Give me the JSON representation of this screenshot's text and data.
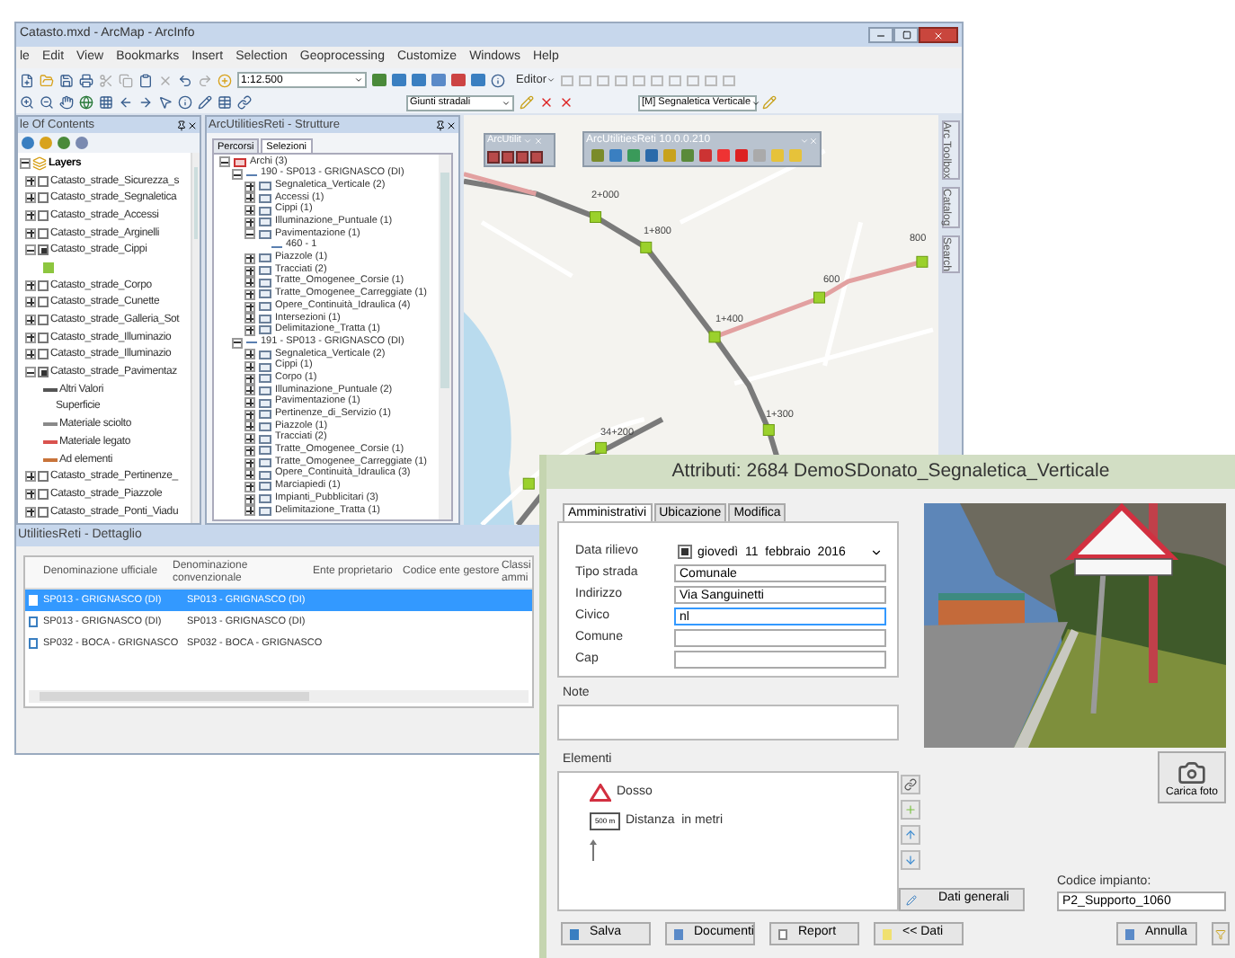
{
  "arcmap": {
    "title": "Catasto.mxd - ArcMap - ArcInfo",
    "menu": [
      "le",
      "Edit",
      "View",
      "Bookmarks",
      "Insert",
      "Selection",
      "Geoprocessing",
      "Customize",
      "Windows",
      "Help"
    ],
    "scale": "1:12.500",
    "editor": "Editor",
    "layer_combo": "Giunti stradali",
    "target_combo": "[M] Segnaletica Verticale"
  },
  "toc": {
    "title": "le Of Contents",
    "items": [
      {
        "label": "Layers",
        "kind": "root",
        "expanded": true,
        "children": [
          {
            "label": "Catasto_strade_Sicurezza_s",
            "kind": "layer",
            "checked": false,
            "expanded": false
          },
          {
            "label": "Catasto_strade_Segnaletica",
            "kind": "layer",
            "checked": false,
            "expanded": false
          },
          {
            "label": "Catasto_strade_Accessi",
            "kind": "layer",
            "checked": false,
            "expanded": false
          },
          {
            "label": "Catasto_strade_Arginelli",
            "kind": "layer",
            "checked": false,
            "expanded": false
          },
          {
            "label": "Catasto_strade_Cippi",
            "kind": "layer",
            "checked": true,
            "expanded": true,
            "children": [
              {
                "kind": "legend",
                "color": "#8dc63f"
              }
            ]
          },
          {
            "label": "Catasto_strade_Corpo",
            "kind": "layer",
            "checked": false,
            "expanded": false
          },
          {
            "label": "Catasto_strade_Cunette",
            "kind": "layer",
            "checked": false,
            "expanded": false
          },
          {
            "label": "Catasto_strade_Galleria_Sot",
            "kind": "layer",
            "checked": false,
            "expanded": false
          },
          {
            "label": "Catasto_strade_Illuminazio",
            "kind": "layer",
            "checked": false,
            "expanded": false
          },
          {
            "label": "Catasto_strade_Illuminazio",
            "kind": "layer",
            "checked": false,
            "expanded": false
          },
          {
            "label": "Catasto_strade_Pavimentaz",
            "kind": "layer",
            "checked": true,
            "expanded": true,
            "children": [
              {
                "label": "Altri Valori",
                "kind": "legend",
                "color": "#555555"
              },
              {
                "label": "Superficie",
                "kind": "heading"
              },
              {
                "label": "Materiale sciolto",
                "kind": "legend",
                "color": "#8a8a8a"
              },
              {
                "label": "Materiale legato",
                "kind": "legend",
                "color": "#d9534f"
              },
              {
                "label": "Ad elementi",
                "kind": "legend",
                "color": "#c8743a"
              }
            ]
          },
          {
            "label": "Catasto_strade_Pertinenze_",
            "kind": "layer",
            "checked": false,
            "expanded": false
          },
          {
            "label": "Catasto_strade_Piazzole",
            "kind": "layer",
            "checked": false,
            "expanded": false
          },
          {
            "label": "Catasto_strade_Ponti_Viadu",
            "kind": "layer",
            "checked": false,
            "expanded": false
          }
        ]
      }
    ]
  },
  "structure": {
    "title": "ArcUtilitiesReti - Strutture",
    "tabs": [
      {
        "label": "Percorsi",
        "selected": false
      },
      {
        "label": "Selezioni",
        "selected": true
      }
    ],
    "tree": [
      {
        "label": "Archi (3)",
        "expanded": true,
        "children": [
          {
            "label": "190 - SP013 - GRIGNASCO (DI)",
            "expanded": true,
            "children": [
              {
                "label": "Segnaletica_Verticale (2)",
                "expanded": false
              },
              {
                "label": "Accessi (1)",
                "expanded": false
              },
              {
                "label": "Cippi (1)",
                "expanded": false
              },
              {
                "label": "Illuminazione_Puntuale (1)",
                "expanded": false
              },
              {
                "label": "Pavimentazione (1)",
                "expanded": true,
                "children": [
                  {
                    "label": "460 - 1"
                  }
                ]
              },
              {
                "label": "Piazzole (1)",
                "expanded": false
              },
              {
                "label": "Tracciati (2)",
                "expanded": false
              },
              {
                "label": "Tratte_Omogenee_Corsie (1)",
                "expanded": false
              },
              {
                "label": "Tratte_Omogenee_Carreggiate (1)",
                "expanded": false
              },
              {
                "label": "Opere_Continuità_Idraulica (4)",
                "expanded": false
              },
              {
                "label": "Intersezioni (1)",
                "expanded": false
              },
              {
                "label": "Delimitazione_Tratta (1)",
                "expanded": false
              }
            ]
          },
          {
            "label": "191 - SP013 - GRIGNASCO (DI)",
            "expanded": true,
            "children": [
              {
                "label": "Segnaletica_Verticale (2)",
                "expanded": false
              },
              {
                "label": "Cippi (1)",
                "expanded": false
              },
              {
                "label": "Corpo (1)",
                "expanded": false
              },
              {
                "label": "Illuminazione_Puntuale (2)",
                "expanded": false
              },
              {
                "label": "Pavimentazione (1)",
                "expanded": false
              },
              {
                "label": "Pertinenze_di_Servizio (1)",
                "expanded": false
              },
              {
                "label": "Piazzole (1)",
                "expanded": false
              },
              {
                "label": "Tracciati (2)",
                "expanded": false
              },
              {
                "label": "Tratte_Omogenee_Corsie (1)",
                "expanded": false
              },
              {
                "label": "Tratte_Omogenee_Carreggiate (1)",
                "expanded": false
              },
              {
                "label": "Opere_Continuità_Idraulica (3)",
                "expanded": false
              },
              {
                "label": "Marciapiedi (1)",
                "expanded": false
              },
              {
                "label": "Impianti_Pubblicitari (3)",
                "expanded": false
              },
              {
                "label": "Delimitazione_Tratta (1)",
                "expanded": false
              }
            ]
          }
        ]
      }
    ]
  },
  "map": {
    "toolbars": [
      "ArcUtilit",
      "ArcUtilitiesReti 10.0.0.210"
    ],
    "labels": [
      "2+000",
      "1+800",
      "1+400",
      "1+300",
      "34+200",
      "800",
      "600"
    ],
    "dock_tabs": [
      "Arc Toolbox",
      "Catalog",
      "Search"
    ]
  },
  "detail": {
    "title": "UtilitiesReti - Dettaglio",
    "columns": [
      "Denominazione ufficiale",
      "Denominazione convenzionale",
      "Ente proprietario",
      "Codice ente gestore",
      "Classi ammi"
    ],
    "rows": [
      {
        "cells": [
          "SP013 - GRIGNASCO (DI)",
          "SP013 - GRIGNASCO (DI)"
        ],
        "selected": true
      },
      {
        "cells": [
          "SP013 - GRIGNASCO (DI)",
          "SP013 - GRIGNASCO (DI)"
        ],
        "selected": false
      },
      {
        "cells": [
          "SP032 - BOCA - GRIGNASCO",
          "SP032 - BOCA - GRIGNASCO"
        ],
        "selected": false
      }
    ]
  },
  "dialog": {
    "title": "Attributi: 2684 DemoSDonato_Segnaletica_Verticale",
    "tabs": [
      {
        "label": "Amministrativi",
        "selected": true
      },
      {
        "label": "Ubicazione",
        "selected": false
      },
      {
        "label": "Modifica",
        "selected": false
      }
    ],
    "fields": [
      {
        "label": "Data rilievo",
        "kind": "date",
        "checked": true,
        "value": "giovedì  11  febbraio  2016",
        "focused": false
      },
      {
        "label": "Tipo strada",
        "kind": "text",
        "value": "Comunale",
        "focused": false
      },
      {
        "label": "Indirizzo",
        "kind": "text",
        "value": "Via Sanguinetti",
        "focused": false
      },
      {
        "label": "Civico",
        "kind": "text",
        "value": "nl",
        "focused": true
      },
      {
        "label": "Comune",
        "kind": "text",
        "focused": false
      },
      {
        "label": "Cap",
        "kind": "text",
        "focused": false
      }
    ],
    "note_label": "Note",
    "elements_label": "Elementi",
    "elements": [
      {
        "kind": "warning",
        "label": "Dosso"
      },
      {
        "kind": "distance",
        "sign": "500 m",
        "label": "Distanza  in metri"
      },
      {
        "kind": "arrow"
      }
    ],
    "photo_button": "Carica foto",
    "general_button": "Dati generali",
    "code_label": "Codice impianto:",
    "code_value": "P2_Supporto_1060",
    "buttons": [
      {
        "kind": "save",
        "label": "Salva"
      },
      {
        "kind": "document",
        "label": "Documenti"
      },
      {
        "kind": "report",
        "label": "Report"
      },
      {
        "kind": "back",
        "label": "<< Dati"
      },
      {
        "kind": "cancel",
        "label": "Annulla"
      },
      {
        "kind": "filter"
      }
    ]
  }
}
